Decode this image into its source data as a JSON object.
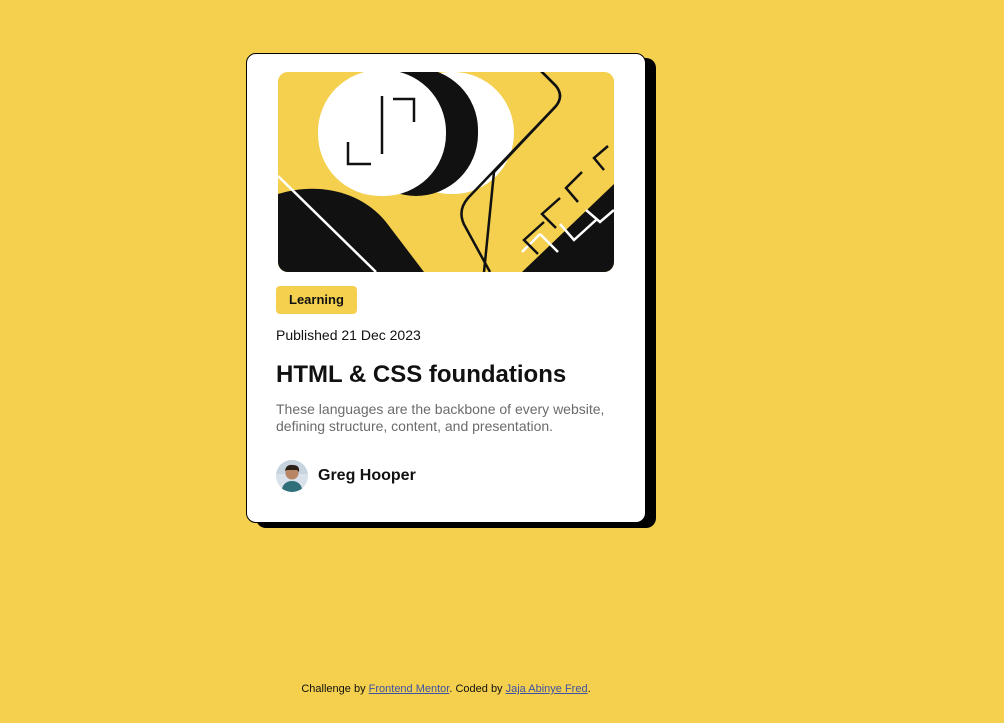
{
  "page": {
    "background_color": "#F4D04E"
  },
  "card": {
    "hero_image_alt": "illustration-article",
    "category_tag": "Learning",
    "published": "Published 21 Dec 2023",
    "title": "HTML & CSS foundations",
    "description": "These languages are the backbone of every website, defining structure, content, and presentation.",
    "author": {
      "name": "Greg Hooper",
      "avatar_icon": "avatar-photo"
    },
    "colors": {
      "accent": "#F4D04E",
      "card_background": "#FFFFFF",
      "shadow": "#000000",
      "text": "#111111",
      "muted_text": "#6B6B6B"
    }
  },
  "footer": {
    "prefix": "Challenge by",
    "frontend_mentor_link": "Frontend Mentor",
    "middle": ". Coded by",
    "coder_link": "Jaja Abinye Fred",
    "suffix": "."
  }
}
